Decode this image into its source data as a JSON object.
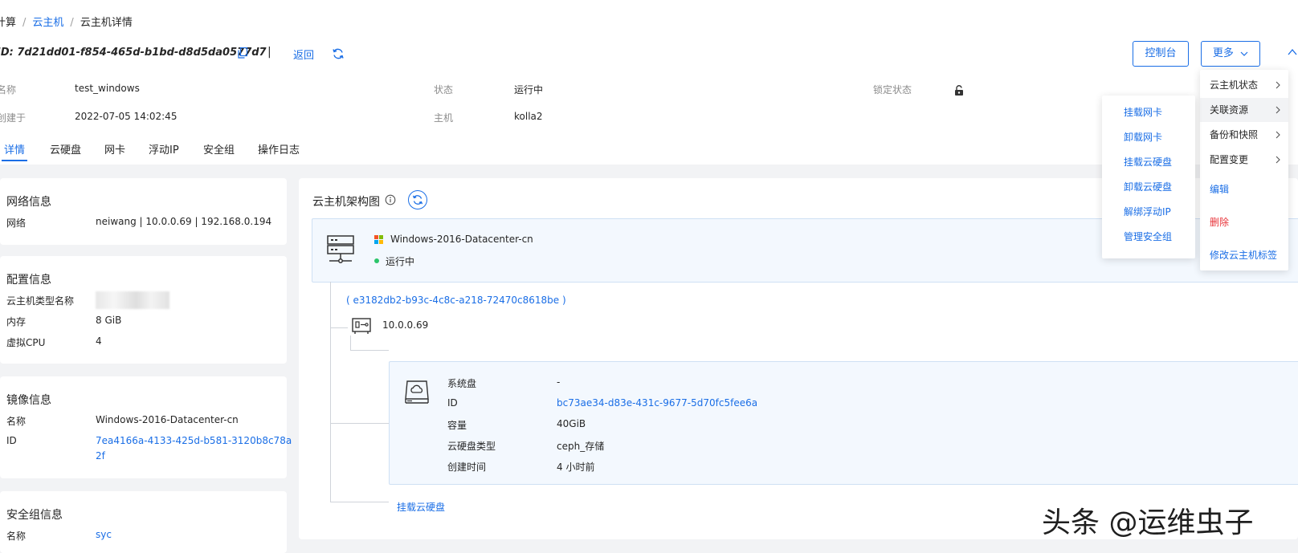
{
  "breadcrumb": {
    "items": [
      "计算",
      "云主机",
      "云主机详情"
    ]
  },
  "header": {
    "id_label": "ID:",
    "id_value": "7d21dd01-f854-465d-b1bd-d8d5da0577d7",
    "divider": "|",
    "back_label": "返回",
    "console_label": "控制台",
    "more_label": "更多"
  },
  "meta": {
    "name_label": "名称",
    "name_value": "test_windows",
    "status_label": "状态",
    "status_value": "运行中",
    "lock_label": "锁定状态",
    "created_label": "创建于",
    "created_value": "2022-07-05 14:02:45",
    "host_label": "主机",
    "host_value": "kolla2"
  },
  "tabs": [
    "详情",
    "云硬盘",
    "网卡",
    "浮动IP",
    "安全组",
    "操作日志"
  ],
  "cards": {
    "network": {
      "title": "网络信息",
      "label": "网络",
      "value": "neiwang | 10.0.0.69 | 192.168.0.194"
    },
    "config": {
      "title": "配置信息",
      "flavor_label": "云主机类型名称",
      "memory_label": "内存",
      "memory_value": "8 GiB",
      "vcpu_label": "虚拟CPU",
      "vcpu_value": "4"
    },
    "image": {
      "title": "镜像信息",
      "name_label": "名称",
      "name_value": "Windows-2016-Datacenter-cn",
      "id_label": "ID",
      "id_line1": "7ea4166a-4133-425d-b581-3120b8c78a",
      "id_line2": "2f"
    },
    "secgroup": {
      "title": "安全组信息",
      "name_label": "名称",
      "name_value": "syc"
    }
  },
  "topology": {
    "title": "云主机架构图",
    "vm_image": "Windows-2016-Datacenter-cn",
    "vm_status": "运行中",
    "port_id": "( e3182db2-b93c-4c8c-a218-72470c8618be )",
    "port_ip": "10.0.0.69",
    "disk": {
      "system_label": "系统盘",
      "system_value": "-",
      "id_label": "ID",
      "id_value": "bc73ae34-d83e-431c-9677-5d70fc5fee6a",
      "size_label": "容量",
      "size_value": "40GiB",
      "type_label": "云硬盘类型",
      "type_value": "ceph_存储",
      "created_label": "创建时间",
      "created_value": "4 小时前"
    },
    "attach_disk_label": "挂载云硬盘"
  },
  "more_menu": {
    "items": [
      "云主机状态",
      "关联资源",
      "备份和快照",
      "配置变更",
      "编辑",
      "删除",
      "修改云主机标签"
    ]
  },
  "submenu": {
    "items": [
      "挂载网卡",
      "卸载网卡",
      "挂载云硬盘",
      "卸载云硬盘",
      "解绑浮动IP",
      "管理安全组"
    ]
  },
  "watermark": "头条 @运维虫子",
  "colors": {
    "accent": "#1a6ee6",
    "danger": "#e8343a",
    "running": "#2bc56b",
    "page_bg": "#f2f3f5"
  }
}
